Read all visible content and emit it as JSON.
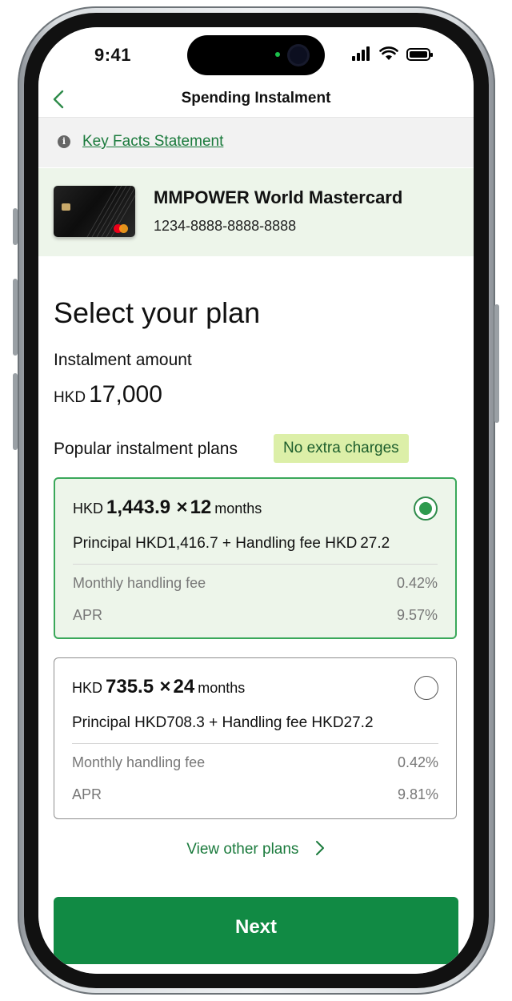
{
  "status_bar": {
    "time": "9:41"
  },
  "nav": {
    "title": "Spending Instalment"
  },
  "kfs": {
    "link_text": "Key Facts Statement"
  },
  "card": {
    "name": "MMPOWER World Mastercard",
    "number": "1234-8888-8888-8888"
  },
  "main": {
    "heading": "Select your plan",
    "amount_label": "Instalment amount",
    "amount_currency": "HKD",
    "amount_value": "17,000",
    "popular_label": "Popular instalment plans",
    "badge": "No extra charges"
  },
  "plans": [
    {
      "currency": "HKD",
      "monthly_amount": "1,443.9",
      "times": "×",
      "months_count": "12",
      "months_label": "months",
      "breakdown": "Principal HKD1,416.7 + Handling fee HKD 27.2",
      "fee_label": "Monthly handling fee",
      "fee_value": "0.42%",
      "apr_label": "APR",
      "apr_value": "9.57%",
      "selected": true
    },
    {
      "currency": "HKD",
      "monthly_amount": "735.5",
      "times": "×",
      "months_count": "24",
      "months_label": "months",
      "breakdown": "Principal HKD708.3 + Handling fee HKD27.2",
      "fee_label": "Monthly handling fee",
      "fee_value": "0.42%",
      "apr_label": "APR",
      "apr_value": "9.81%",
      "selected": false
    }
  ],
  "view_other": "View other plans",
  "next_button": "Next",
  "colors": {
    "brand_green": "#118a44",
    "link_green": "#1a7a3c",
    "badge_bg": "#dcefa8",
    "selected_bg": "#edf5ea"
  },
  "icons": [
    "back-chevron-icon",
    "info-icon",
    "radio-selected-icon",
    "radio-unselected-icon",
    "chevron-right-icon",
    "signal-icon",
    "wifi-icon",
    "battery-icon"
  ]
}
